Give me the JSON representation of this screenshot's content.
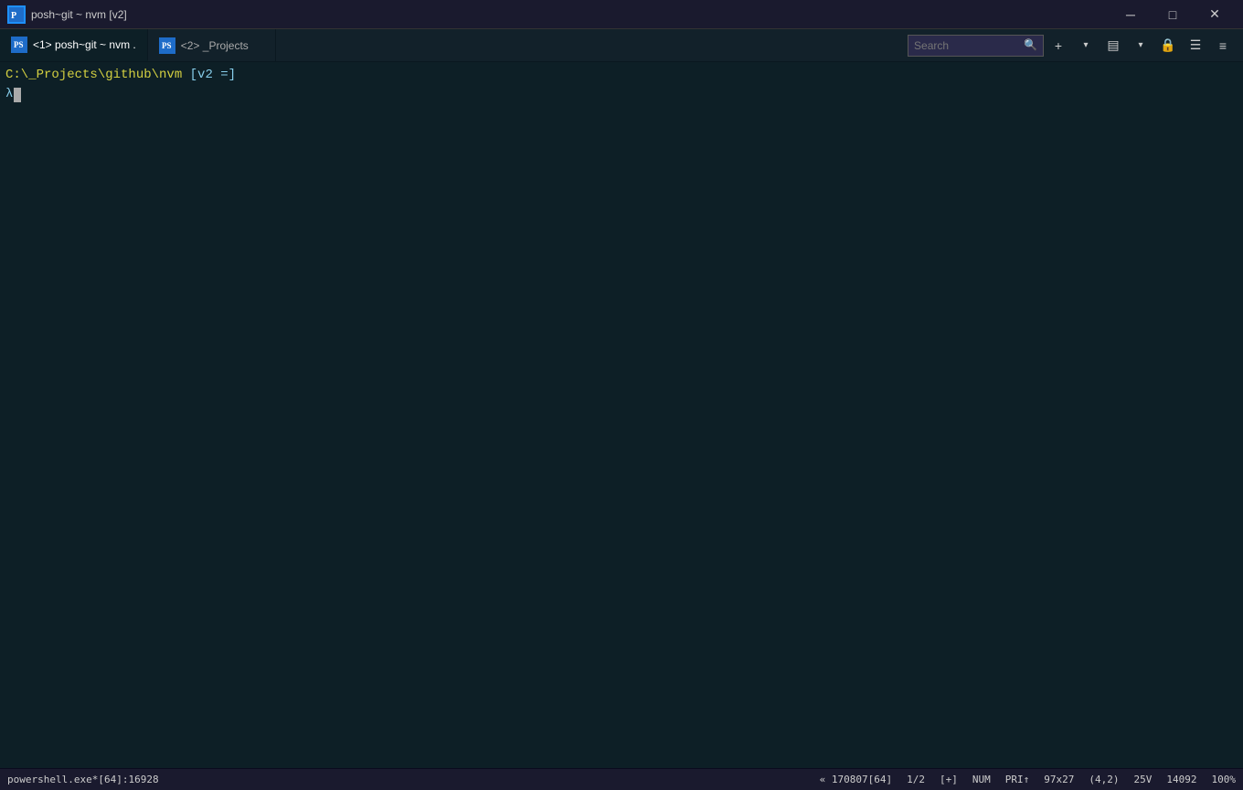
{
  "titleBar": {
    "title": "posh~git ~ nvm [v2]",
    "iconLabel": "PS",
    "minimize": "─",
    "maximize": "□",
    "close": "✕"
  },
  "tabs": [
    {
      "id": "tab1",
      "label": "<1> posh~git ~ nvm .",
      "active": true,
      "iconLabel": "PS"
    },
    {
      "id": "tab2",
      "label": "<2>  _Projects",
      "active": false,
      "iconLabel": "PS"
    }
  ],
  "toolbar": {
    "searchPlaceholder": "Search",
    "addButton": "+",
    "dropdownButton": "▾",
    "viewButton": "▤",
    "viewDropdown": "▾",
    "lockButton": "🔒",
    "settingsButton": "☰",
    "moreButton": "≡"
  },
  "terminal": {
    "promptPath": "C:\\_Projects\\github\\nvm",
    "promptBranch": "[v2",
    "promptStatus": "=]",
    "lambdaSymbol": "λ",
    "cursor": ""
  },
  "statusBar": {
    "left": "powershell.exe*[64]:16928",
    "lineCol": "« 170807[64]",
    "pane": "1/2",
    "mode": "[+]",
    "num": "NUM",
    "pri": "PRI↑",
    "size": "97x27",
    "position": "(4,2)",
    "voltage": "25V",
    "lineCount": "14092",
    "zoom": "100%"
  }
}
